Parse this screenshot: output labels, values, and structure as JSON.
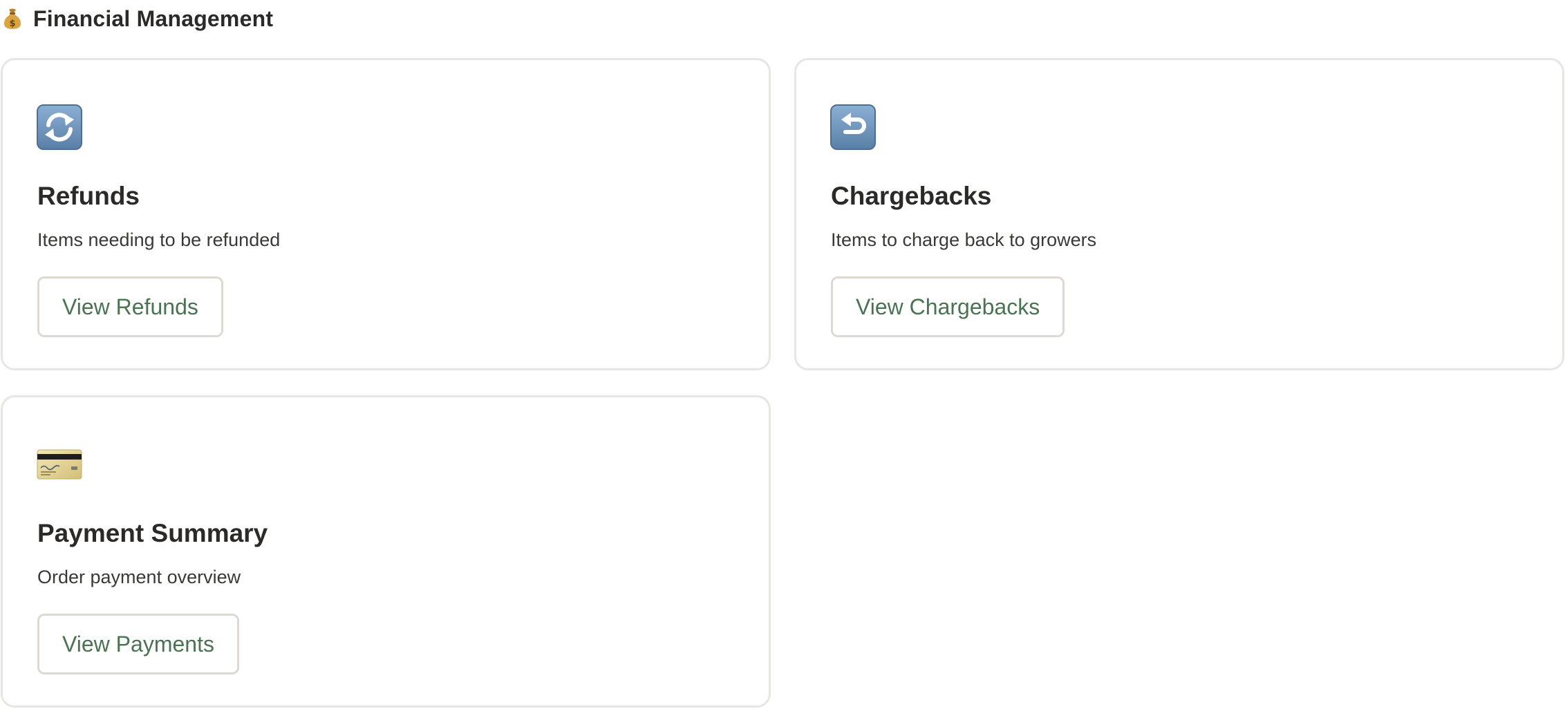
{
  "header": {
    "title": "Financial Management",
    "icon": "money-bag-icon"
  },
  "cards": [
    {
      "icon": "refresh-icon",
      "title": "Refunds",
      "description": "Items needing to be refunded",
      "button_label": "View Refunds"
    },
    {
      "icon": "return-arrow-icon",
      "title": "Chargebacks",
      "description": "Items to charge back to growers",
      "button_label": "View Chargebacks"
    },
    {
      "icon": "credit-card-icon",
      "title": "Payment Summary",
      "description": "Order payment overview",
      "button_label": "View Payments"
    }
  ],
  "colors": {
    "accent_green": "#4a7352",
    "icon_blue": "#6a8fb5",
    "card_border": "#e8e6e2",
    "text": "#2b2a28"
  }
}
